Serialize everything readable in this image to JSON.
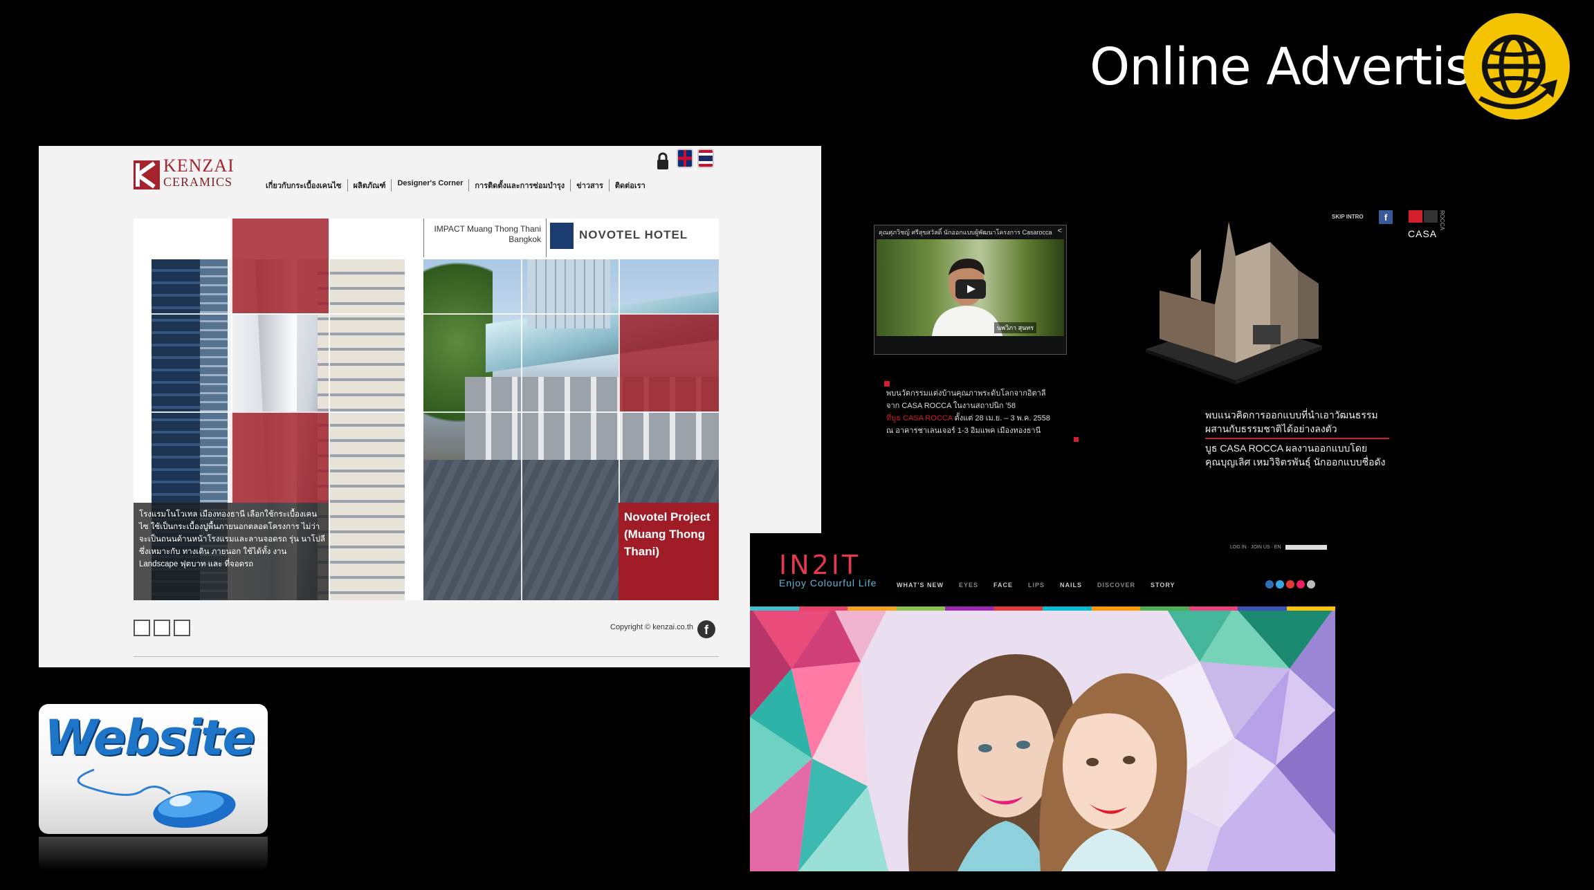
{
  "header": {
    "title": "Online Advertising",
    "accent_color": "#f5c400",
    "icon": "globe-arrow-icon"
  },
  "kenzai": {
    "logo_line1": "KENZAI",
    "logo_line2": "CERAMICS",
    "brand_color": "#a4232c",
    "nav": [
      "เกี่ยวกับกระเบื้องเคนไซ",
      "ผลิตภัณฑ์",
      "Designer's Corner",
      "การติดตั้งและการซ่อมบำรุง",
      "ข่าวสาร",
      "ติดต่อเรา"
    ],
    "impact_label": "IMPACT Muang Thong Thani Bangkok",
    "hotel_name": "NOVOTEL HOTEL",
    "caption": "โรงแรมโนโวเทล เมืองทองธานี เลือกใช้กระเบื้องเคนไซ ใช้เป็นกระเบื้องปูพื้นภายนอกตลอดโครงการ ไม่ว่าจะเป็นถนนด้านหน้าโรงแรมและลานจอดรถ รุ่น นาโปลี ซึ่งเหมาะกับ ทางเดิน ภายนอก ใช้ได้ทั้ง งาน Landscape ฟุตบาท และ ที่จอดรถ",
    "project_label": "Novotel Project (Muang Thong Thani)",
    "copyright": "Copyright © kenzai.co.th"
  },
  "casa_rocca": {
    "video_title": "คุณศุภวิชญ์ ศรีสุขสวัสดิ์ นักออกแบบผู้พัฒนาโครงการ Casarocca",
    "presenter_tag": "นพวิภา สุนทร",
    "skip_label": "SKIP INTRO",
    "logo_text": "CASA",
    "logo_vertical": "ROCCA",
    "left_text_1": "พบนวัตกรรมแต่งบ้านคุณภาพระดับโลกจากอิตาลี",
    "left_text_2": "จาก CASA ROCCA ในงานสถาปนิก '58",
    "left_text_3_red": "ที่บูธ CASA ROCCA",
    "left_text_3": " ตั้งแต่ 28 เม.ย. – 3 พ.ค. 2558",
    "left_text_4": "ณ อาคารชาเลนเจอร์ 1-3 อิมแพค เมืองทองธานี",
    "title_1": "พบแนวคิดการออกแบบที่นำเอาวัฒนธรรม",
    "title_2": "ผสานกับธรรมชาติได้อย่างลงตัว",
    "sub_1": "บูธ CASA ROCCA ผลงานออกแบบโดย",
    "sub_2": "คุณบุญเลิศ เหมวิจิตรพันธุ์ นักออกแบบชื่อดัง",
    "accent": "#d21f2b"
  },
  "in2it": {
    "logo": "IN2IT",
    "tagline": "Enjoy Colourful Life",
    "top_links": "LOG IN · JOIN US · EN",
    "nav": [
      "WHAT'S NEW",
      "EYES",
      "FACE",
      "LIPS",
      "NAILS",
      "DISCOVER",
      "STORY"
    ],
    "stripe_colors": [
      "#3cc3d1",
      "#e8426b",
      "#f4a21d",
      "#8bc34a",
      "#9c27b0",
      "#e53935",
      "#00bcd4",
      "#ff9800",
      "#4caf50",
      "#ec407a",
      "#3f51b5",
      "#ffc107"
    ],
    "social_colors": [
      "#2d6fb8",
      "#35a9e1",
      "#e53935",
      "#e91e63",
      "#bbbbbb"
    ]
  },
  "website_badge": {
    "label": "Website"
  }
}
